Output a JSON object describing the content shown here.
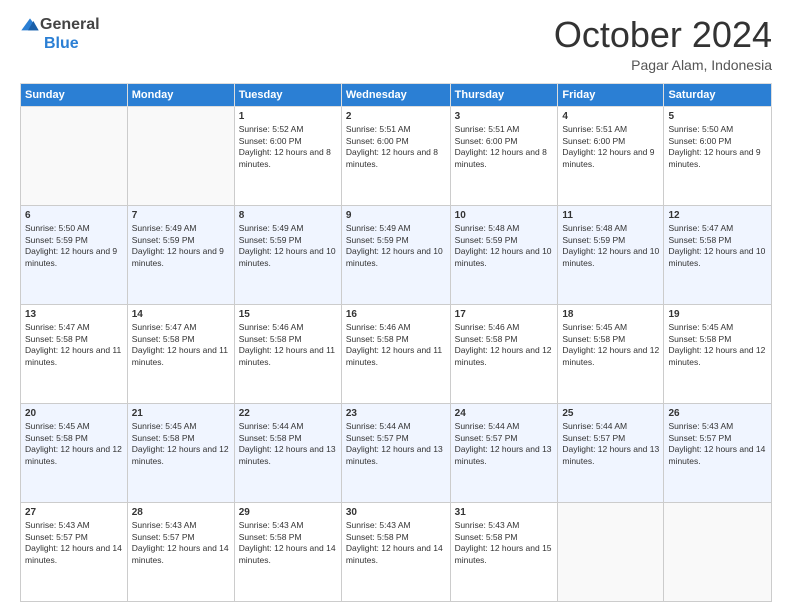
{
  "header": {
    "logo_general": "General",
    "logo_blue": "Blue",
    "month": "October 2024",
    "location": "Pagar Alam, Indonesia"
  },
  "days_of_week": [
    "Sunday",
    "Monday",
    "Tuesday",
    "Wednesday",
    "Thursday",
    "Friday",
    "Saturday"
  ],
  "weeks": [
    [
      {
        "day": "",
        "sunrise": "",
        "sunset": "",
        "daylight": ""
      },
      {
        "day": "",
        "sunrise": "",
        "sunset": "",
        "daylight": ""
      },
      {
        "day": "1",
        "sunrise": "Sunrise: 5:52 AM",
        "sunset": "Sunset: 6:00 PM",
        "daylight": "Daylight: 12 hours and 8 minutes."
      },
      {
        "day": "2",
        "sunrise": "Sunrise: 5:51 AM",
        "sunset": "Sunset: 6:00 PM",
        "daylight": "Daylight: 12 hours and 8 minutes."
      },
      {
        "day": "3",
        "sunrise": "Sunrise: 5:51 AM",
        "sunset": "Sunset: 6:00 PM",
        "daylight": "Daylight: 12 hours and 8 minutes."
      },
      {
        "day": "4",
        "sunrise": "Sunrise: 5:51 AM",
        "sunset": "Sunset: 6:00 PM",
        "daylight": "Daylight: 12 hours and 9 minutes."
      },
      {
        "day": "5",
        "sunrise": "Sunrise: 5:50 AM",
        "sunset": "Sunset: 6:00 PM",
        "daylight": "Daylight: 12 hours and 9 minutes."
      }
    ],
    [
      {
        "day": "6",
        "sunrise": "Sunrise: 5:50 AM",
        "sunset": "Sunset: 5:59 PM",
        "daylight": "Daylight: 12 hours and 9 minutes."
      },
      {
        "day": "7",
        "sunrise": "Sunrise: 5:49 AM",
        "sunset": "Sunset: 5:59 PM",
        "daylight": "Daylight: 12 hours and 9 minutes."
      },
      {
        "day": "8",
        "sunrise": "Sunrise: 5:49 AM",
        "sunset": "Sunset: 5:59 PM",
        "daylight": "Daylight: 12 hours and 10 minutes."
      },
      {
        "day": "9",
        "sunrise": "Sunrise: 5:49 AM",
        "sunset": "Sunset: 5:59 PM",
        "daylight": "Daylight: 12 hours and 10 minutes."
      },
      {
        "day": "10",
        "sunrise": "Sunrise: 5:48 AM",
        "sunset": "Sunset: 5:59 PM",
        "daylight": "Daylight: 12 hours and 10 minutes."
      },
      {
        "day": "11",
        "sunrise": "Sunrise: 5:48 AM",
        "sunset": "Sunset: 5:59 PM",
        "daylight": "Daylight: 12 hours and 10 minutes."
      },
      {
        "day": "12",
        "sunrise": "Sunrise: 5:47 AM",
        "sunset": "Sunset: 5:58 PM",
        "daylight": "Daylight: 12 hours and 10 minutes."
      }
    ],
    [
      {
        "day": "13",
        "sunrise": "Sunrise: 5:47 AM",
        "sunset": "Sunset: 5:58 PM",
        "daylight": "Daylight: 12 hours and 11 minutes."
      },
      {
        "day": "14",
        "sunrise": "Sunrise: 5:47 AM",
        "sunset": "Sunset: 5:58 PM",
        "daylight": "Daylight: 12 hours and 11 minutes."
      },
      {
        "day": "15",
        "sunrise": "Sunrise: 5:46 AM",
        "sunset": "Sunset: 5:58 PM",
        "daylight": "Daylight: 12 hours and 11 minutes."
      },
      {
        "day": "16",
        "sunrise": "Sunrise: 5:46 AM",
        "sunset": "Sunset: 5:58 PM",
        "daylight": "Daylight: 12 hours and 11 minutes."
      },
      {
        "day": "17",
        "sunrise": "Sunrise: 5:46 AM",
        "sunset": "Sunset: 5:58 PM",
        "daylight": "Daylight: 12 hours and 12 minutes."
      },
      {
        "day": "18",
        "sunrise": "Sunrise: 5:45 AM",
        "sunset": "Sunset: 5:58 PM",
        "daylight": "Daylight: 12 hours and 12 minutes."
      },
      {
        "day": "19",
        "sunrise": "Sunrise: 5:45 AM",
        "sunset": "Sunset: 5:58 PM",
        "daylight": "Daylight: 12 hours and 12 minutes."
      }
    ],
    [
      {
        "day": "20",
        "sunrise": "Sunrise: 5:45 AM",
        "sunset": "Sunset: 5:58 PM",
        "daylight": "Daylight: 12 hours and 12 minutes."
      },
      {
        "day": "21",
        "sunrise": "Sunrise: 5:45 AM",
        "sunset": "Sunset: 5:58 PM",
        "daylight": "Daylight: 12 hours and 12 minutes."
      },
      {
        "day": "22",
        "sunrise": "Sunrise: 5:44 AM",
        "sunset": "Sunset: 5:58 PM",
        "daylight": "Daylight: 12 hours and 13 minutes."
      },
      {
        "day": "23",
        "sunrise": "Sunrise: 5:44 AM",
        "sunset": "Sunset: 5:57 PM",
        "daylight": "Daylight: 12 hours and 13 minutes."
      },
      {
        "day": "24",
        "sunrise": "Sunrise: 5:44 AM",
        "sunset": "Sunset: 5:57 PM",
        "daylight": "Daylight: 12 hours and 13 minutes."
      },
      {
        "day": "25",
        "sunrise": "Sunrise: 5:44 AM",
        "sunset": "Sunset: 5:57 PM",
        "daylight": "Daylight: 12 hours and 13 minutes."
      },
      {
        "day": "26",
        "sunrise": "Sunrise: 5:43 AM",
        "sunset": "Sunset: 5:57 PM",
        "daylight": "Daylight: 12 hours and 14 minutes."
      }
    ],
    [
      {
        "day": "27",
        "sunrise": "Sunrise: 5:43 AM",
        "sunset": "Sunset: 5:57 PM",
        "daylight": "Daylight: 12 hours and 14 minutes."
      },
      {
        "day": "28",
        "sunrise": "Sunrise: 5:43 AM",
        "sunset": "Sunset: 5:57 PM",
        "daylight": "Daylight: 12 hours and 14 minutes."
      },
      {
        "day": "29",
        "sunrise": "Sunrise: 5:43 AM",
        "sunset": "Sunset: 5:58 PM",
        "daylight": "Daylight: 12 hours and 14 minutes."
      },
      {
        "day": "30",
        "sunrise": "Sunrise: 5:43 AM",
        "sunset": "Sunset: 5:58 PM",
        "daylight": "Daylight: 12 hours and 14 minutes."
      },
      {
        "day": "31",
        "sunrise": "Sunrise: 5:43 AM",
        "sunset": "Sunset: 5:58 PM",
        "daylight": "Daylight: 12 hours and 15 minutes."
      },
      {
        "day": "",
        "sunrise": "",
        "sunset": "",
        "daylight": ""
      },
      {
        "day": "",
        "sunrise": "",
        "sunset": "",
        "daylight": ""
      }
    ]
  ]
}
